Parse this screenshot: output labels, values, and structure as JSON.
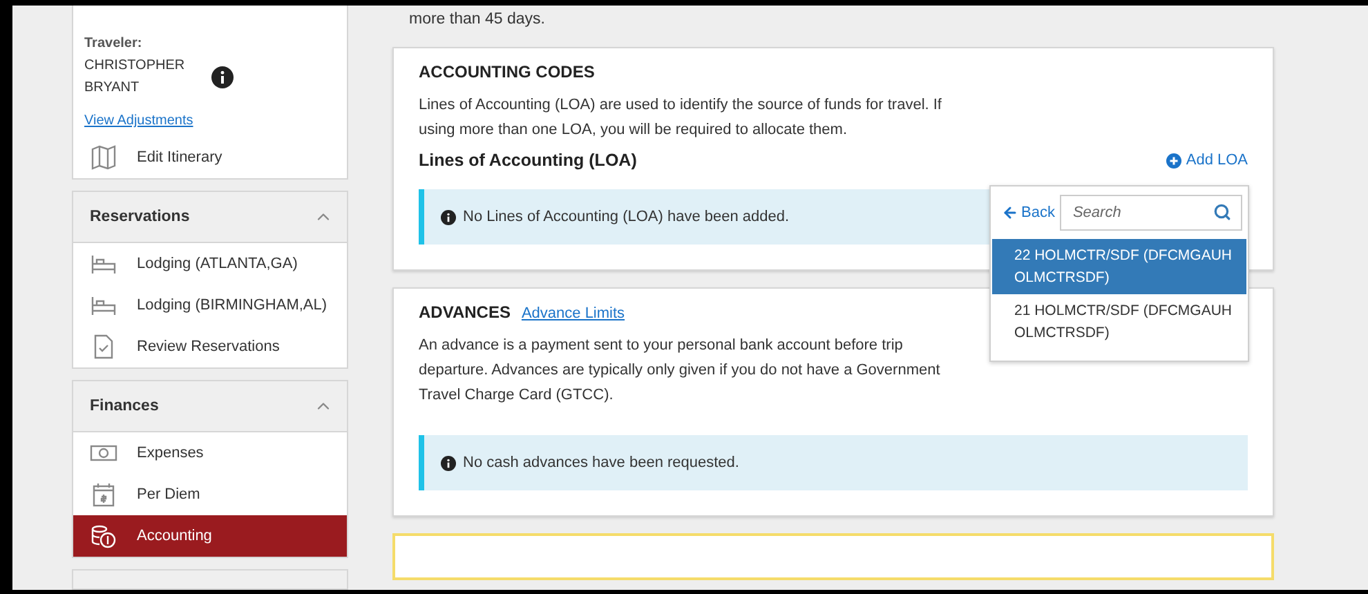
{
  "intro_tail": "more than 45 days.",
  "traveler": {
    "label": "Traveler:",
    "name": "CHRISTOPHER BRYANT",
    "link": "View Adjustments"
  },
  "sidebar": {
    "top_items": [
      {
        "label": "Edit Itinerary",
        "kind": "map",
        "selected": false
      }
    ],
    "sections": [
      {
        "title": "Reservations",
        "expanded": true,
        "items": [
          {
            "label": "Lodging (ATLANTA,GA)",
            "kind": "bed",
            "selected": false
          },
          {
            "label": "Lodging (BIRMINGHAM,AL)",
            "kind": "bed",
            "selected": false
          },
          {
            "label": "Review Reservations",
            "kind": "doc",
            "selected": false
          }
        ]
      },
      {
        "title": "Finances",
        "expanded": true,
        "items": [
          {
            "label": "Expenses",
            "kind": "money",
            "selected": false
          },
          {
            "label": "Per Diem",
            "kind": "calendar",
            "selected": false
          },
          {
            "label": "Accounting",
            "kind": "coins",
            "selected": true
          }
        ]
      }
    ]
  },
  "accounting": {
    "title": "ACCOUNTING CODES",
    "description": "Lines of Accounting (LOA) are used to identify the source of funds for travel. If using more than one LOA, you will be required to allocate them.",
    "subtitle": "Lines of Accounting (LOA)",
    "add_button": "Add LOA",
    "notice": "No Lines of Accounting (LOA) have been added."
  },
  "dropdown": {
    "back": "Back",
    "search": {
      "placeholder": "Search"
    },
    "options": [
      {
        "label": "22 HOLMCTR/SDF (DFCMGAUH OLMCTRSDF)",
        "selected": true
      },
      {
        "label": "21 HOLMCTR/SDF (DFCMGAUH OLMCTRSDF)",
        "selected": false
      }
    ]
  },
  "advances": {
    "title": "ADVANCES",
    "link": "Advance Limits",
    "description": "An advance is a payment sent to your personal bank account before trip departure. Advances are typically only given if you do not have a Government Travel Charge Card (GTCC).",
    "notice": "No cash advances have been requested."
  }
}
